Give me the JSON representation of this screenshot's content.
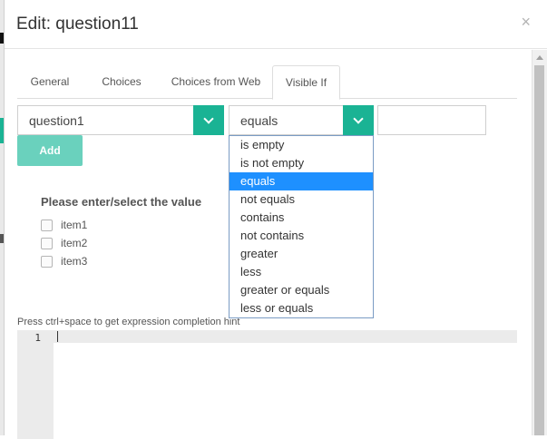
{
  "modal": {
    "title": "Edit: question11",
    "close_glyph": "×"
  },
  "tabs": [
    {
      "label": "General"
    },
    {
      "label": "Choices"
    },
    {
      "label": "Choices from Web"
    },
    {
      "label": "Visible If",
      "active": true
    }
  ],
  "condition": {
    "question_select_value": "question1",
    "operator_select_value": "equals",
    "value_input": "",
    "add_label": "Add",
    "accent_color": "#1ab394"
  },
  "operator_options": [
    "is empty",
    "is not empty",
    "equals",
    "not equals",
    "contains",
    "not contains",
    "greater",
    "less",
    "greater or equals",
    "less or equals"
  ],
  "selected_operator": "equals",
  "value_panel": {
    "title": "Please enter/select the value",
    "items": [
      "item1",
      "item2",
      "item3"
    ]
  },
  "editor": {
    "hint": "Press ctrl+space to get expression completion hint",
    "line_number": "1",
    "content": ""
  },
  "icons": {
    "close": "close-icon",
    "dropdown": "chevron-down-icon"
  }
}
